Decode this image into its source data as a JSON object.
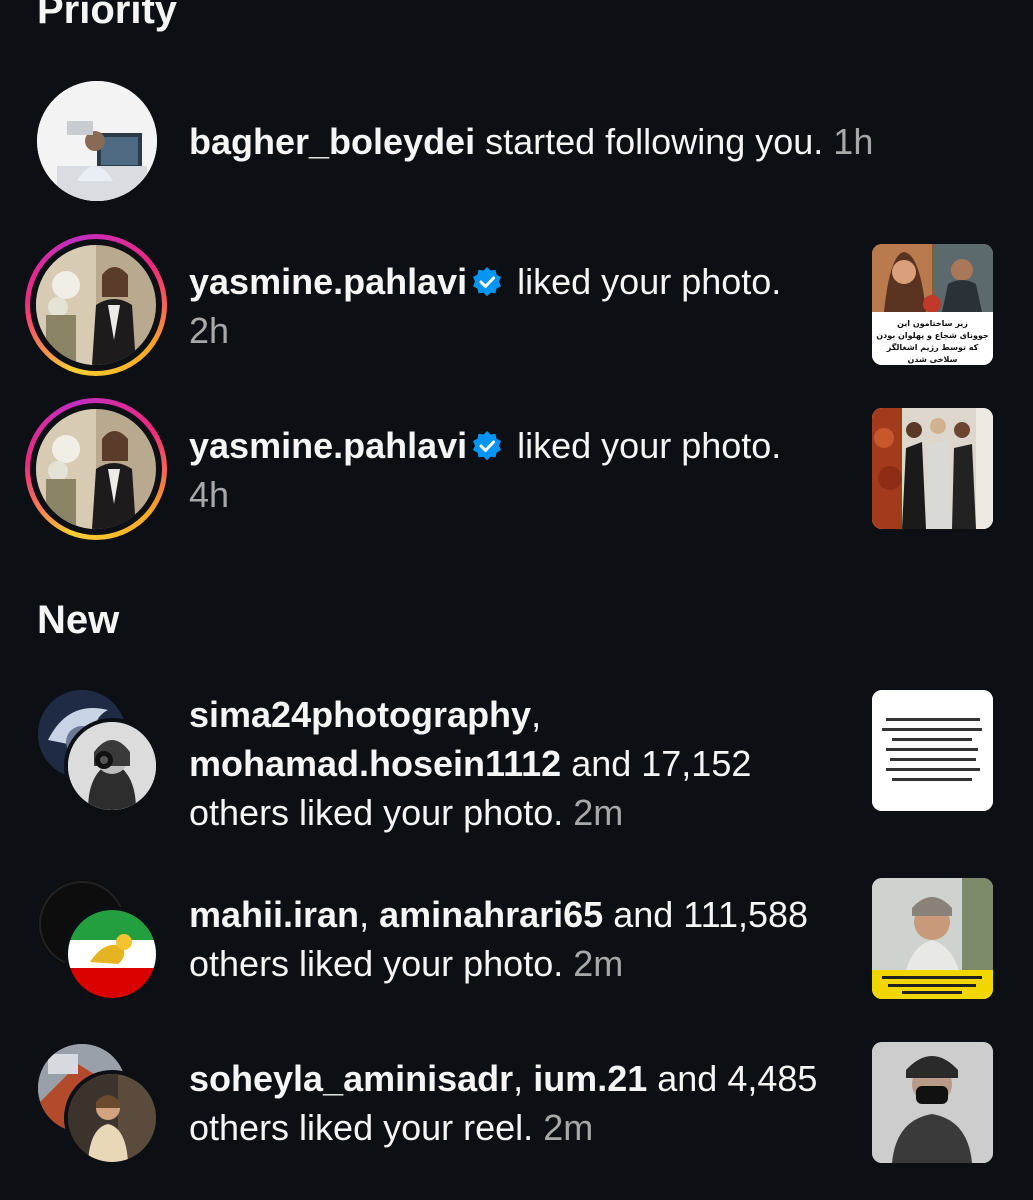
{
  "sections": {
    "priority": "Priority",
    "new": "New"
  },
  "notifications": [
    {
      "user": "bagher_boleydei",
      "action": " started following you.",
      "time": "1h"
    },
    {
      "user": "yasmine.pahlavi",
      "verified": true,
      "action": " liked your photo.",
      "time": "2h",
      "thumb_text": [
        "زیر ساختامون این",
        "جوونای شجاع و پهلوان بودن",
        "که توسط رژیم اشغالگر سلاخی شدن"
      ]
    },
    {
      "user": "yasmine.pahlavi",
      "verified": true,
      "action": " liked your photo.",
      "time": "4h"
    },
    {
      "user1": "sima24photography",
      "sep1": ",",
      "user2": "mohamad.hosein1112",
      "action": " and 17,152 others liked your photo.",
      "time": "2m"
    },
    {
      "user1": "mahii.iran",
      "sep1": ", ",
      "user2": "aminahrari65",
      "action": " and 111,588 others liked your photo.",
      "time": "2m"
    },
    {
      "user1": "soheyla_aminisadr",
      "sep1": ", ",
      "user2": "ium.21",
      "action": " and 4,485 others liked your reel.",
      "time": "2m"
    }
  ],
  "colors": {
    "background": "#0c0f14",
    "text": "#f5f5f5",
    "muted": "#a8a8a8",
    "verified": "#0095f6"
  }
}
